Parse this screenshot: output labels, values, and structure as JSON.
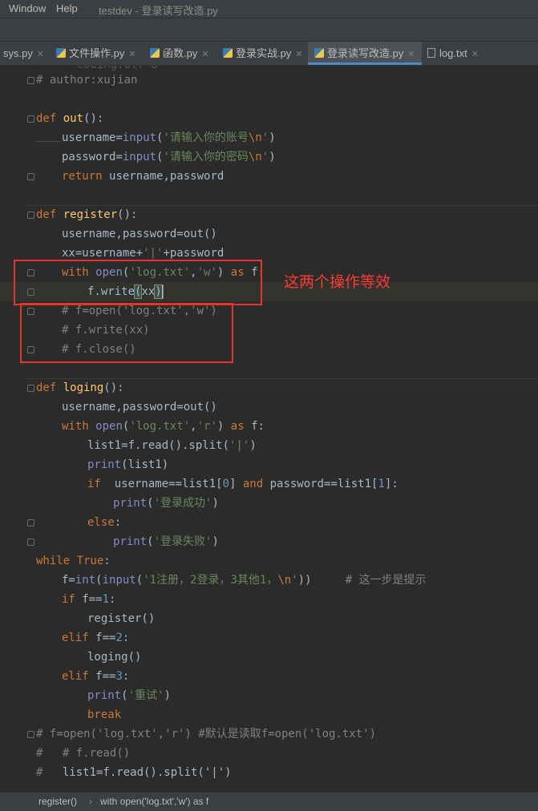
{
  "menu": {
    "window": "Window",
    "help": "Help",
    "title": "testdev - 登录读写改造.py"
  },
  "tabs": [
    {
      "label": "sys.py"
    },
    {
      "label": "文件操作.py"
    },
    {
      "label": "函数.py"
    },
    {
      "label": "登录实战.py"
    },
    {
      "label": "登录读写改造.py",
      "active": true
    },
    {
      "label": "log.txt"
    }
  ],
  "code": {
    "l00": "# author:xujian",
    "l02": "def out():",
    "l03": "username=input('请输入你的账号\\n')",
    "l04": "password=input('请输入你的密码\\n')",
    "l05": "return username,password",
    "l07": "def register():",
    "l08": "username,password=out()",
    "l09": "xx=username+'|'+password",
    "l10": "with open('log.txt','w') as f:",
    "l11": "f.write(xx)",
    "l12": "# f=open('log.txt','w')",
    "l13": "# f.write(xx)",
    "l14": "# f.close()",
    "l16": "def loging():",
    "l17": "username,password=out()",
    "l18": "with open('log.txt','r') as f:",
    "l19": "list1=f.read().split('|')",
    "l20": "print(list1)",
    "l21": "if username==list1[0] and password==list1[1]:",
    "l22": "print('登录成功')",
    "l23": "else:",
    "l24": "print('登录失败')",
    "l25": "while True:",
    "l26": "f=int(input('1注册，2登录，3其他1，\\n')) # 这一步是提示",
    "l27": "if f==1:",
    "l28": "register()",
    "l29": "elif f==2:",
    "l30": "loging()",
    "l31": "elif f==3:",
    "l32": "print('重试')",
    "l33": "break",
    "l34": "# f=open('log.txt','r') #默认是读取f=open('log.txt')",
    "l35": "# f.read()",
    "l36": "list1=f.read().split('|')"
  },
  "annotation": {
    "text": "这两个操作等效",
    "color": "#e8322c"
  },
  "breadcrumb": {
    "item1": "register()",
    "separator": "›",
    "item2": "with open('log.txt','w') as f"
  }
}
